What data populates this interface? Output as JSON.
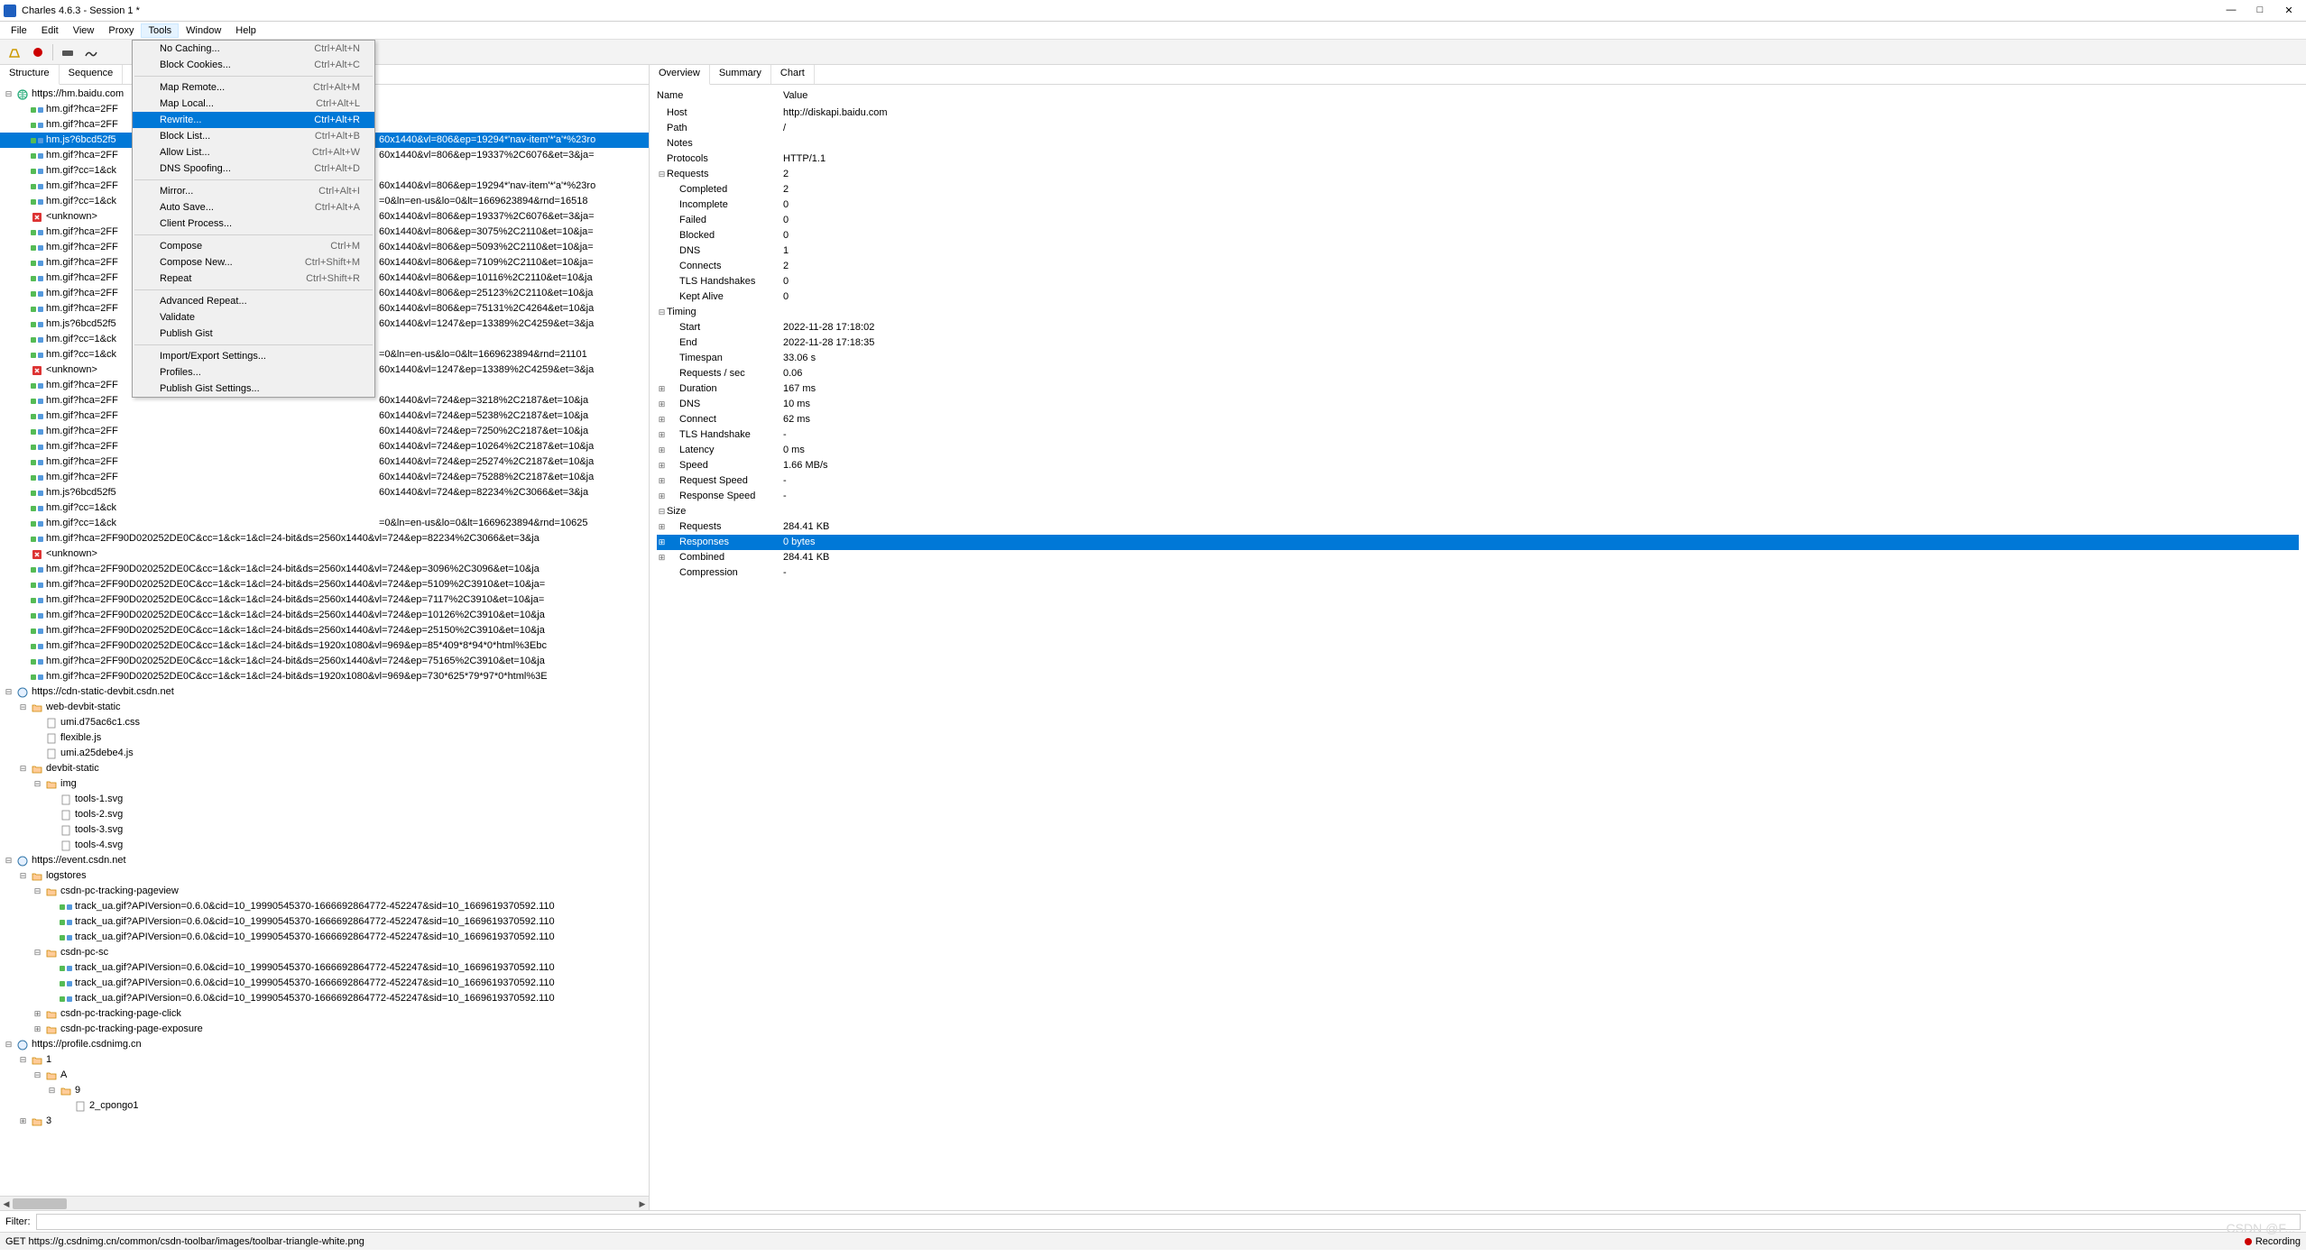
{
  "window": {
    "title": "Charles 4.6.3 - Session 1 *"
  },
  "menubar": [
    "File",
    "Edit",
    "View",
    "Proxy",
    "Tools",
    "Window",
    "Help"
  ],
  "menubar_open": "Tools",
  "tools_menu": [
    {
      "label": "No Caching...",
      "shortcut": "Ctrl+Alt+N"
    },
    {
      "label": "Block Cookies...",
      "shortcut": "Ctrl+Alt+C"
    },
    {
      "sep": true
    },
    {
      "label": "Map Remote...",
      "shortcut": "Ctrl+Alt+M"
    },
    {
      "label": "Map Local...",
      "shortcut": "Ctrl+Alt+L"
    },
    {
      "label": "Rewrite...",
      "shortcut": "Ctrl+Alt+R",
      "hl": true
    },
    {
      "label": "Block List...",
      "shortcut": "Ctrl+Alt+B"
    },
    {
      "label": "Allow List...",
      "shortcut": "Ctrl+Alt+W"
    },
    {
      "label": "DNS Spoofing...",
      "shortcut": "Ctrl+Alt+D"
    },
    {
      "sep": true
    },
    {
      "label": "Mirror...",
      "shortcut": "Ctrl+Alt+I"
    },
    {
      "label": "Auto Save...",
      "shortcut": "Ctrl+Alt+A"
    },
    {
      "label": "Client Process...",
      "shortcut": ""
    },
    {
      "sep": true
    },
    {
      "label": "Compose",
      "shortcut": "Ctrl+M"
    },
    {
      "label": "Compose New...",
      "shortcut": "Ctrl+Shift+M"
    },
    {
      "label": "Repeat",
      "shortcut": "Ctrl+Shift+R"
    },
    {
      "sep": true
    },
    {
      "label": "Advanced Repeat...",
      "shortcut": ""
    },
    {
      "label": "Validate",
      "shortcut": ""
    },
    {
      "label": "Publish Gist",
      "shortcut": ""
    },
    {
      "sep": true
    },
    {
      "label": "Import/Export Settings...",
      "shortcut": ""
    },
    {
      "label": "Profiles...",
      "shortcut": ""
    },
    {
      "label": "Publish Gist Settings...",
      "shortcut": ""
    }
  ],
  "left_tabs": [
    "Structure",
    "Sequence"
  ],
  "right_tabs": [
    "Overview",
    "Summary",
    "Chart"
  ],
  "tree": [
    {
      "d": 0,
      "e": "-",
      "i": "globe",
      "t": "https://hm.baidu.com"
    },
    {
      "d": 1,
      "e": "",
      "i": "req",
      "t": "hm.gif?hca=2FF"
    },
    {
      "d": 1,
      "e": "",
      "i": "req",
      "t": "hm.gif?hca=2FF"
    },
    {
      "d": 1,
      "e": "",
      "i": "req",
      "t": "hm.js?6bcd52f5",
      "sel": true,
      "tail": "60x1440&vl=806&ep=19294*'nav-item'*'a'*%23ro"
    },
    {
      "d": 1,
      "e": "",
      "i": "req",
      "t": "hm.gif?hca=2FF",
      "tail": "60x1440&vl=806&ep=19337%2C6076&et=3&ja="
    },
    {
      "d": 1,
      "e": "",
      "i": "req",
      "t": "hm.gif?cc=1&ck"
    },
    {
      "d": 1,
      "e": "",
      "i": "req",
      "t": "hm.gif?hca=2FF",
      "tail": "60x1440&vl=806&ep=19294*'nav-item'*'a'*%23ro"
    },
    {
      "d": 1,
      "e": "",
      "i": "req",
      "t": "hm.gif?cc=1&ck",
      "tail": "=0&ln=en-us&lo=0&lt=1669623894&rnd=16518"
    },
    {
      "d": 1,
      "e": "",
      "i": "err",
      "t": "<unknown>",
      "tail": "60x1440&vl=806&ep=19337%2C6076&et=3&ja="
    },
    {
      "d": 1,
      "e": "",
      "i": "req",
      "t": "hm.gif?hca=2FF",
      "tail": "60x1440&vl=806&ep=3075%2C2110&et=10&ja="
    },
    {
      "d": 1,
      "e": "",
      "i": "req",
      "t": "hm.gif?hca=2FF",
      "tail": "60x1440&vl=806&ep=5093%2C2110&et=10&ja="
    },
    {
      "d": 1,
      "e": "",
      "i": "req",
      "t": "hm.gif?hca=2FF",
      "tail": "60x1440&vl=806&ep=7109%2C2110&et=10&ja="
    },
    {
      "d": 1,
      "e": "",
      "i": "req",
      "t": "hm.gif?hca=2FF",
      "tail": "60x1440&vl=806&ep=10116%2C2110&et=10&ja"
    },
    {
      "d": 1,
      "e": "",
      "i": "req",
      "t": "hm.gif?hca=2FF",
      "tail": "60x1440&vl=806&ep=25123%2C2110&et=10&ja"
    },
    {
      "d": 1,
      "e": "",
      "i": "req",
      "t": "hm.gif?hca=2FF",
      "tail": "60x1440&vl=806&ep=75131%2C4264&et=10&ja"
    },
    {
      "d": 1,
      "e": "",
      "i": "req",
      "t": "hm.js?6bcd52f5",
      "tail": "60x1440&vl=1247&ep=13389%2C4259&et=3&ja"
    },
    {
      "d": 1,
      "e": "",
      "i": "req",
      "t": "hm.gif?cc=1&ck"
    },
    {
      "d": 1,
      "e": "",
      "i": "req",
      "t": "hm.gif?cc=1&ck",
      "tail": "=0&ln=en-us&lo=0&lt=1669623894&rnd=21101"
    },
    {
      "d": 1,
      "e": "",
      "i": "err",
      "t": "<unknown>",
      "tail": "60x1440&vl=1247&ep=13389%2C4259&et=3&ja"
    },
    {
      "d": 1,
      "e": "",
      "i": "req",
      "t": "hm.gif?hca=2FF"
    },
    {
      "d": 1,
      "e": "",
      "i": "req",
      "t": "hm.gif?hca=2FF",
      "tail": "60x1440&vl=724&ep=3218%2C2187&et=10&ja"
    },
    {
      "d": 1,
      "e": "",
      "i": "req",
      "t": "hm.gif?hca=2FF",
      "tail": "60x1440&vl=724&ep=5238%2C2187&et=10&ja"
    },
    {
      "d": 1,
      "e": "",
      "i": "req",
      "t": "hm.gif?hca=2FF",
      "tail": "60x1440&vl=724&ep=7250%2C2187&et=10&ja"
    },
    {
      "d": 1,
      "e": "",
      "i": "req",
      "t": "hm.gif?hca=2FF",
      "tail": "60x1440&vl=724&ep=10264%2C2187&et=10&ja"
    },
    {
      "d": 1,
      "e": "",
      "i": "req",
      "t": "hm.gif?hca=2FF",
      "tail": "60x1440&vl=724&ep=25274%2C2187&et=10&ja"
    },
    {
      "d": 1,
      "e": "",
      "i": "req",
      "t": "hm.gif?hca=2FF",
      "tail": "60x1440&vl=724&ep=75288%2C2187&et=10&ja"
    },
    {
      "d": 1,
      "e": "",
      "i": "req",
      "t": "hm.js?6bcd52f5",
      "tail": "60x1440&vl=724&ep=82234%2C3066&et=3&ja"
    },
    {
      "d": 1,
      "e": "",
      "i": "req",
      "t": "hm.gif?cc=1&ck"
    },
    {
      "d": 1,
      "e": "",
      "i": "req",
      "t": "hm.gif?cc=1&ck",
      "tail": "=0&ln=en-us&lo=0&lt=1669623894&rnd=10625"
    },
    {
      "d": 1,
      "e": "",
      "i": "req",
      "t": "hm.gif?hca=2FF90D020252DE0C&cc=1&ck=1&cl=24-bit&ds=2560x1440&vl=724&ep=82234%2C3066&et=3&ja"
    },
    {
      "d": 1,
      "e": "",
      "i": "err",
      "t": "<unknown>"
    },
    {
      "d": 1,
      "e": "",
      "i": "req",
      "t": "hm.gif?hca=2FF90D020252DE0C&cc=1&ck=1&cl=24-bit&ds=2560x1440&vl=724&ep=3096%2C3096&et=10&ja"
    },
    {
      "d": 1,
      "e": "",
      "i": "req",
      "t": "hm.gif?hca=2FF90D020252DE0C&cc=1&ck=1&cl=24-bit&ds=2560x1440&vl=724&ep=5109%2C3910&et=10&ja="
    },
    {
      "d": 1,
      "e": "",
      "i": "req",
      "t": "hm.gif?hca=2FF90D020252DE0C&cc=1&ck=1&cl=24-bit&ds=2560x1440&vl=724&ep=7117%2C3910&et=10&ja="
    },
    {
      "d": 1,
      "e": "",
      "i": "req",
      "t": "hm.gif?hca=2FF90D020252DE0C&cc=1&ck=1&cl=24-bit&ds=2560x1440&vl=724&ep=10126%2C3910&et=10&ja"
    },
    {
      "d": 1,
      "e": "",
      "i": "req",
      "t": "hm.gif?hca=2FF90D020252DE0C&cc=1&ck=1&cl=24-bit&ds=2560x1440&vl=724&ep=25150%2C3910&et=10&ja"
    },
    {
      "d": 1,
      "e": "",
      "i": "req",
      "t": "hm.gif?hca=2FF90D020252DE0C&cc=1&ck=1&cl=24-bit&ds=1920x1080&vl=969&ep=85*409*8*94*0*html%3Ebc"
    },
    {
      "d": 1,
      "e": "",
      "i": "req",
      "t": "hm.gif?hca=2FF90D020252DE0C&cc=1&ck=1&cl=24-bit&ds=2560x1440&vl=724&ep=75165%2C3910&et=10&ja"
    },
    {
      "d": 1,
      "e": "",
      "i": "req",
      "t": "hm.gif?hca=2FF90D020252DE0C&cc=1&ck=1&cl=24-bit&ds=1920x1080&vl=969&ep=730*625*79*97*0*html%3E"
    },
    {
      "d": 0,
      "e": "-",
      "i": "host",
      "t": "https://cdn-static-devbit.csdn.net"
    },
    {
      "d": 1,
      "e": "-",
      "i": "folder",
      "t": "web-devbit-static"
    },
    {
      "d": 2,
      "e": "",
      "i": "file",
      "t": "umi.d75ac6c1.css"
    },
    {
      "d": 2,
      "e": "",
      "i": "file",
      "t": "flexible.js"
    },
    {
      "d": 2,
      "e": "",
      "i": "file",
      "t": "umi.a25debe4.js"
    },
    {
      "d": 1,
      "e": "-",
      "i": "folder",
      "t": "devbit-static"
    },
    {
      "d": 2,
      "e": "-",
      "i": "folder",
      "t": "img"
    },
    {
      "d": 3,
      "e": "",
      "i": "file",
      "t": "tools-1.svg"
    },
    {
      "d": 3,
      "e": "",
      "i": "file",
      "t": "tools-2.svg"
    },
    {
      "d": 3,
      "e": "",
      "i": "file",
      "t": "tools-3.svg"
    },
    {
      "d": 3,
      "e": "",
      "i": "file",
      "t": "tools-4.svg"
    },
    {
      "d": 0,
      "e": "-",
      "i": "host",
      "t": "https://event.csdn.net"
    },
    {
      "d": 1,
      "e": "-",
      "i": "folder",
      "t": "logstores"
    },
    {
      "d": 2,
      "e": "-",
      "i": "folder",
      "t": "csdn-pc-tracking-pageview"
    },
    {
      "d": 3,
      "e": "",
      "i": "req",
      "t": "track_ua.gif?APIVersion=0.6.0&cid=10_19990545370-1666692864772-452247&sid=10_1669619370592.110"
    },
    {
      "d": 3,
      "e": "",
      "i": "req",
      "t": "track_ua.gif?APIVersion=0.6.0&cid=10_19990545370-1666692864772-452247&sid=10_1669619370592.110"
    },
    {
      "d": 3,
      "e": "",
      "i": "req",
      "t": "track_ua.gif?APIVersion=0.6.0&cid=10_19990545370-1666692864772-452247&sid=10_1669619370592.110"
    },
    {
      "d": 2,
      "e": "-",
      "i": "folder",
      "t": "csdn-pc-sc"
    },
    {
      "d": 3,
      "e": "",
      "i": "req",
      "t": "track_ua.gif?APIVersion=0.6.0&cid=10_19990545370-1666692864772-452247&sid=10_1669619370592.110"
    },
    {
      "d": 3,
      "e": "",
      "i": "req",
      "t": "track_ua.gif?APIVersion=0.6.0&cid=10_19990545370-1666692864772-452247&sid=10_1669619370592.110"
    },
    {
      "d": 3,
      "e": "",
      "i": "req",
      "t": "track_ua.gif?APIVersion=0.6.0&cid=10_19990545370-1666692864772-452247&sid=10_1669619370592.110"
    },
    {
      "d": 2,
      "e": "+",
      "i": "folder",
      "t": "csdn-pc-tracking-page-click"
    },
    {
      "d": 2,
      "e": "+",
      "i": "folder",
      "t": "csdn-pc-tracking-page-exposure"
    },
    {
      "d": 0,
      "e": "-",
      "i": "host",
      "t": "https://profile.csdnimg.cn"
    },
    {
      "d": 1,
      "e": "-",
      "i": "folder",
      "t": "1"
    },
    {
      "d": 2,
      "e": "-",
      "i": "folder",
      "t": "A"
    },
    {
      "d": 3,
      "e": "-",
      "i": "folder",
      "t": "9"
    },
    {
      "d": 4,
      "e": "",
      "i": "file",
      "t": "2_cpongo1"
    },
    {
      "d": 1,
      "e": "+",
      "i": "folder",
      "t": "3"
    }
  ],
  "overview": {
    "header_name": "Name",
    "header_value": "Value",
    "rows": [
      {
        "n": "Host",
        "v": "http://diskapi.baidu.com",
        "d": 0
      },
      {
        "n": "Path",
        "v": "/",
        "d": 0
      },
      {
        "n": "Notes",
        "v": "",
        "d": 0
      },
      {
        "n": "Protocols",
        "v": "HTTP/1.1",
        "d": 0
      },
      {
        "n": "Requests",
        "v": "2",
        "d": 0,
        "e": "-"
      },
      {
        "n": "Completed",
        "v": "2",
        "d": 1
      },
      {
        "n": "Incomplete",
        "v": "0",
        "d": 1
      },
      {
        "n": "Failed",
        "v": "0",
        "d": 1
      },
      {
        "n": "Blocked",
        "v": "0",
        "d": 1
      },
      {
        "n": "DNS",
        "v": "1",
        "d": 1
      },
      {
        "n": "Connects",
        "v": "2",
        "d": 1
      },
      {
        "n": "TLS Handshakes",
        "v": "0",
        "d": 1
      },
      {
        "n": "Kept Alive",
        "v": "0",
        "d": 1
      },
      {
        "n": "Timing",
        "v": "",
        "d": 0,
        "e": "-"
      },
      {
        "n": "Start",
        "v": "2022-11-28 17:18:02",
        "d": 1
      },
      {
        "n": "End",
        "v": "2022-11-28 17:18:35",
        "d": 1
      },
      {
        "n": "Timespan",
        "v": "33.06 s",
        "d": 1
      },
      {
        "n": "Requests / sec",
        "v": "0.06",
        "d": 1
      },
      {
        "n": "Duration",
        "v": "167 ms",
        "d": 1,
        "e": "+"
      },
      {
        "n": "DNS",
        "v": "10 ms",
        "d": 1,
        "e": "+"
      },
      {
        "n": "Connect",
        "v": "62 ms",
        "d": 1,
        "e": "+"
      },
      {
        "n": "TLS Handshake",
        "v": "-",
        "d": 1,
        "e": "+"
      },
      {
        "n": "Latency",
        "v": "0 ms",
        "d": 1,
        "e": "+"
      },
      {
        "n": "Speed",
        "v": "1.66 MB/s",
        "d": 1,
        "e": "+"
      },
      {
        "n": "Request Speed",
        "v": "-",
        "d": 1,
        "e": "+"
      },
      {
        "n": "Response Speed",
        "v": "-",
        "d": 1,
        "e": "+"
      },
      {
        "n": "Size",
        "v": "",
        "d": 0,
        "e": "-"
      },
      {
        "n": "Requests",
        "v": "284.41 KB",
        "d": 1,
        "e": "+"
      },
      {
        "n": "Responses",
        "v": "0 bytes",
        "d": 1,
        "e": "+",
        "sel": true
      },
      {
        "n": "Combined",
        "v": "284.41 KB",
        "d": 1,
        "e": "+"
      },
      {
        "n": "Compression",
        "v": "-",
        "d": 1
      }
    ]
  },
  "filter_label": "Filter:",
  "status": {
    "text": "GET https://g.csdnimg.cn/common/csdn-toolbar/images/toolbar-triangle-white.png",
    "recording": "Recording"
  },
  "watermark": "CSDN @F..."
}
